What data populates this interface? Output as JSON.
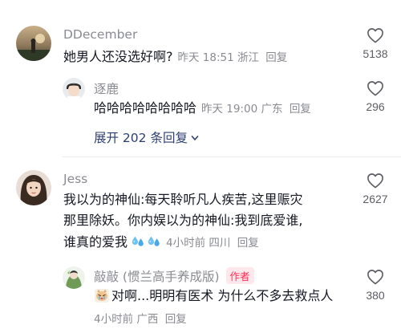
{
  "comments": [
    {
      "username": "DDecember",
      "text": "她男人还没选好啊?",
      "time": "昨天 18:51",
      "location": "浙江",
      "reply_label": "回复",
      "likes": "5138",
      "replies": [
        {
          "username": "逐鹿",
          "text": "哈哈哈哈哈哈哈哈",
          "time": "昨天 19:00",
          "location": "广东",
          "reply_label": "回复",
          "likes": "296"
        }
      ],
      "expand_label": "展开 202 条回复"
    },
    {
      "username": "Jess",
      "text_lines": [
        "我以为的神仙:每天聆听凡人疾苦,这里赈灾",
        "那里除妖。你内娱以为的神仙:我到底爱谁,",
        "谁真的爱我"
      ],
      "emojis": [
        "sweat-droplets-emoji",
        "sweat-droplets-emoji"
      ],
      "time": "4小时前",
      "location": "四川",
      "reply_label": "回复",
      "likes": "2627",
      "replies": [
        {
          "username": "敲敲 (惯兰高手养成版)",
          "author_tag": "作者",
          "sticker": "crying-cat-sticker",
          "text": "对啊...明明有医术 为什么不多去救点人",
          "time": "4小时前",
          "location": "广西",
          "reply_label": "回复",
          "likes": "380"
        }
      ]
    }
  ],
  "colors": {
    "name": "#8a8b91",
    "text": "#161823",
    "expand": "#2c3e72",
    "author_tag": "#ff2f56",
    "author_tag_bg": "#ffe8ec"
  }
}
